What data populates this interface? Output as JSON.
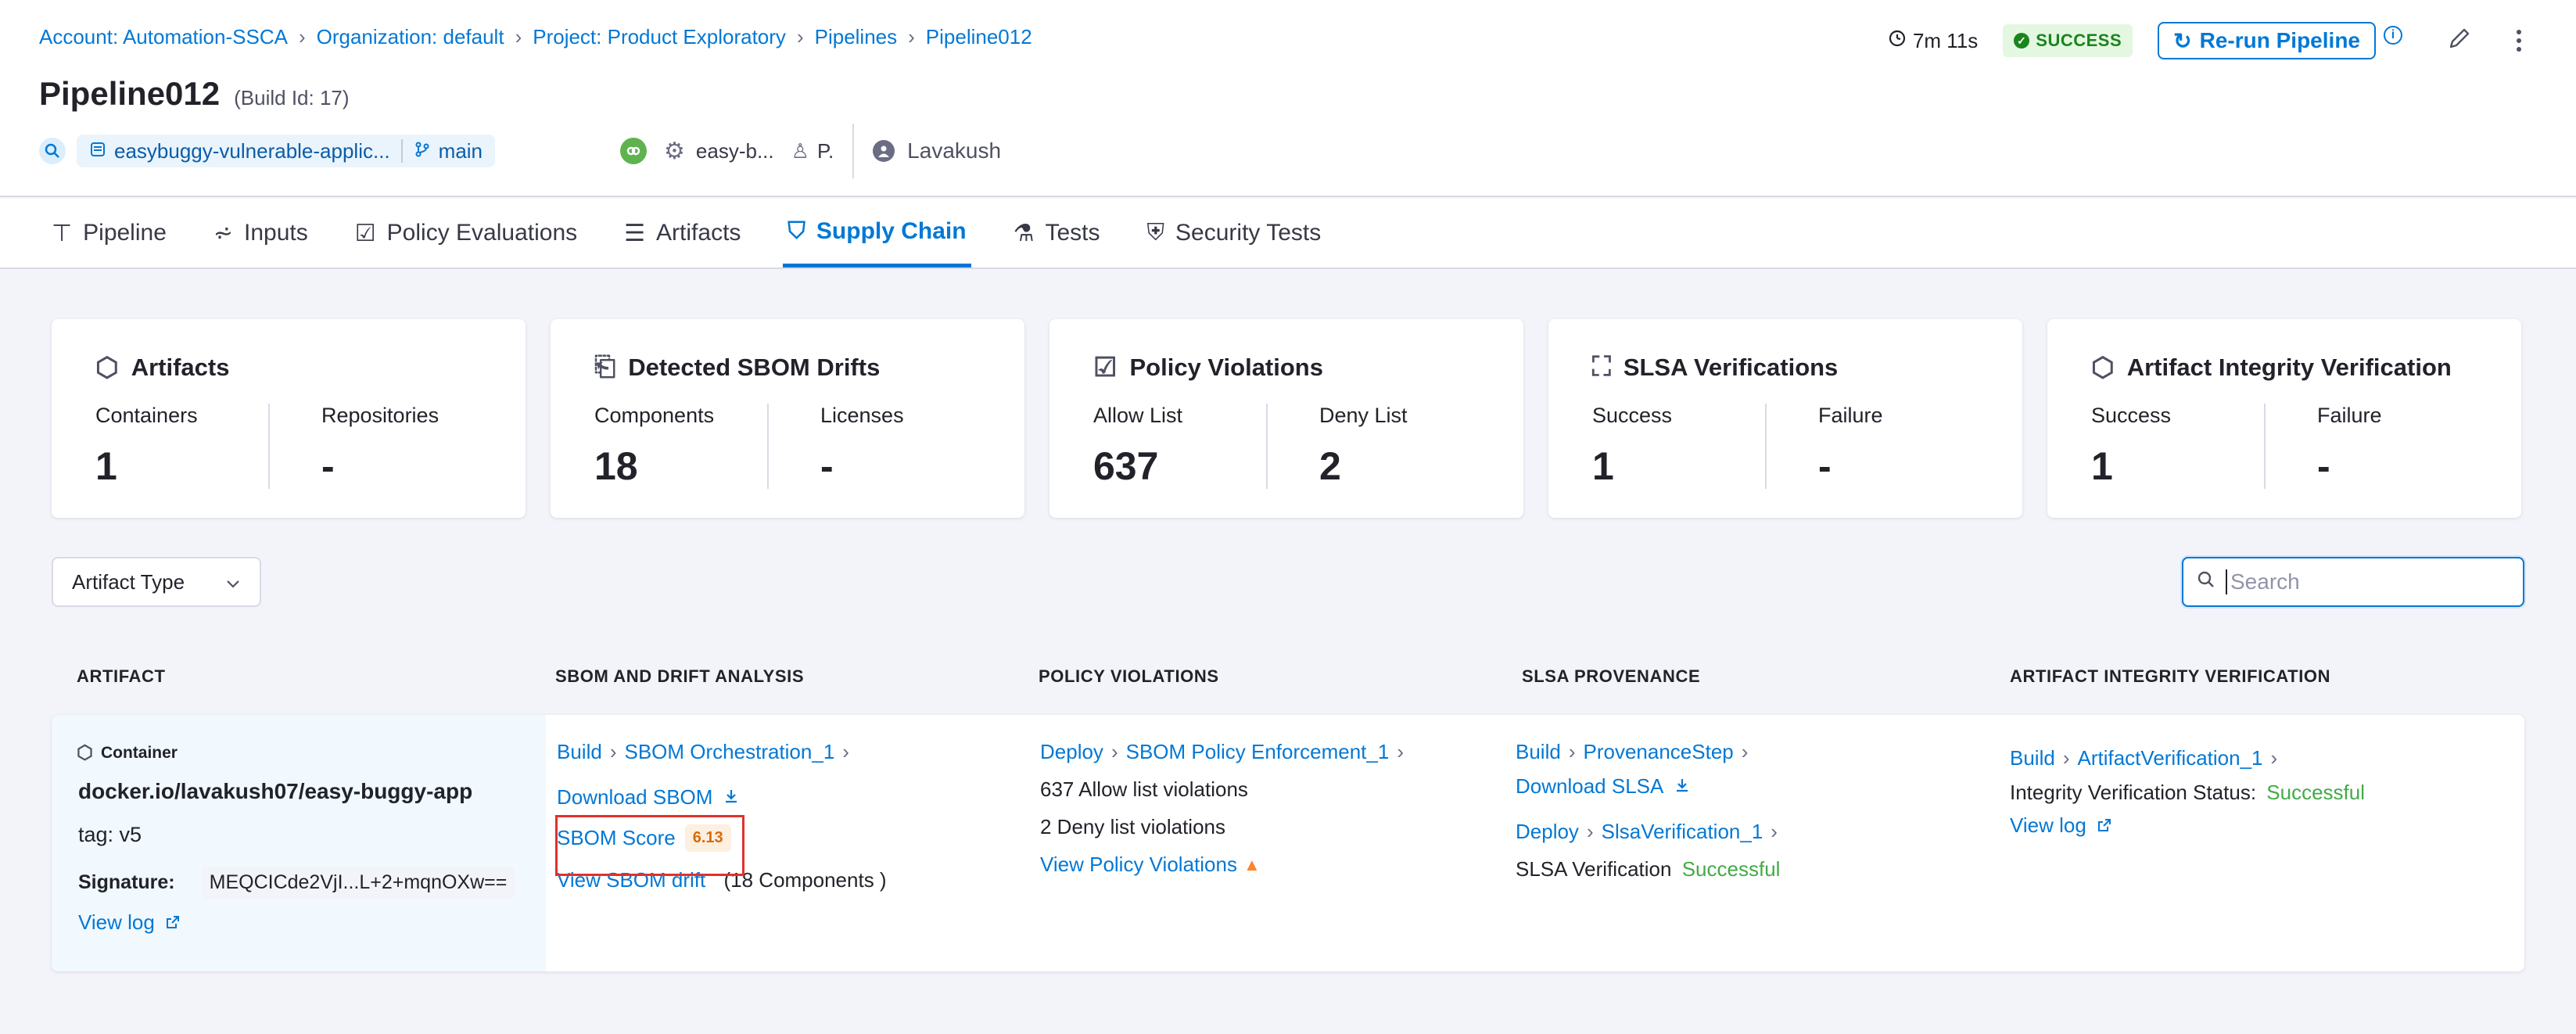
{
  "breadcrumb": [
    "Account: Automation-SSCA",
    "Organization: default",
    "Project: Product Exploratory",
    "Pipelines",
    "Pipeline012"
  ],
  "header": {
    "title": "Pipeline012",
    "build_id": "(Build Id: 17)",
    "duration": "7m 11s",
    "status": "SUCCESS",
    "rerun_label": "Re-run Pipeline",
    "repo": "easybuggy-vulnerable-applic...",
    "branch": "main",
    "infra": "easy-b...",
    "infra_short": "P.",
    "user": "Lavakush"
  },
  "colors": {
    "accent": "#0278d5",
    "success": "#42ab45",
    "highlight": "#e0312e",
    "score": "#d86b0a"
  },
  "tabs": [
    {
      "label": "Pipeline",
      "icon": "pipeline-icon"
    },
    {
      "label": "Inputs",
      "icon": "inputs-icon"
    },
    {
      "label": "Policy Evaluations",
      "icon": "policy-icon"
    },
    {
      "label": "Artifacts",
      "icon": "artifacts-icon"
    },
    {
      "label": "Supply Chain",
      "icon": "supply-chain-icon",
      "active": true
    },
    {
      "label": "Tests",
      "icon": "tests-icon"
    },
    {
      "label": "Security Tests",
      "icon": "security-tests-icon"
    }
  ],
  "cards": [
    {
      "title": "Artifacts",
      "cols": [
        {
          "label": "Containers",
          "value": "1"
        },
        {
          "label": "Repositories",
          "value": "-"
        }
      ]
    },
    {
      "title": "Detected SBOM Drifts",
      "cols": [
        {
          "label": "Components",
          "value": "18"
        },
        {
          "label": "Licenses",
          "value": "-"
        }
      ]
    },
    {
      "title": "Policy Violations",
      "cols": [
        {
          "label": "Allow List",
          "value": "637"
        },
        {
          "label": "Deny List",
          "value": "2"
        }
      ]
    },
    {
      "title": "SLSA Verifications",
      "cols": [
        {
          "label": "Success",
          "value": "1"
        },
        {
          "label": "Failure",
          "value": "-"
        }
      ]
    },
    {
      "title": "Artifact Integrity Verification",
      "cols": [
        {
          "label": "Success",
          "value": "1"
        },
        {
          "label": "Failure",
          "value": "-"
        }
      ]
    }
  ],
  "filters": {
    "artifact_type": "Artifact Type",
    "search_placeholder": "Search"
  },
  "table": {
    "headers": [
      "ARTIFACT",
      "SBOM AND DRIFT ANALYSIS",
      "POLICY VIOLATIONS",
      "SLSA PROVENANCE",
      "ARTIFACT INTEGRITY VERIFICATION"
    ],
    "row": {
      "artifact": {
        "kind": "Container",
        "name": "docker.io/lavakush07/easy-buggy-app",
        "tag": "tag: v5",
        "signature_label": "Signature:",
        "signature_value": "MEQCICde2VjI...L+2+mqnOXw==",
        "view_log": "View log"
      },
      "sbom": {
        "stage": "Build",
        "step": "SBOM Orchestration_1",
        "download": "Download SBOM",
        "score_label": "SBOM Score",
        "score_value": "6.13",
        "drift": "View SBOM drift",
        "drift_count": "(18 Components )"
      },
      "policy": {
        "stage": "Deploy",
        "step": "SBOM Policy Enforcement_1",
        "allow": "637 Allow list violations",
        "deny": "2 Deny list violations",
        "view": "View Policy Violations"
      },
      "slsa": {
        "stage": "Build",
        "step": "ProvenanceStep",
        "download": "Download SLSA",
        "verify_stage": "Deploy",
        "verify_step": "SlsaVerification_1",
        "verification_label": "SLSA Verification",
        "verification_status": "Successful"
      },
      "integrity": {
        "stage": "Build",
        "step": "ArtifactVerification_1",
        "status_label": "Integrity Verification Status:",
        "status_value": "Successful",
        "view_log": "View log"
      }
    }
  }
}
